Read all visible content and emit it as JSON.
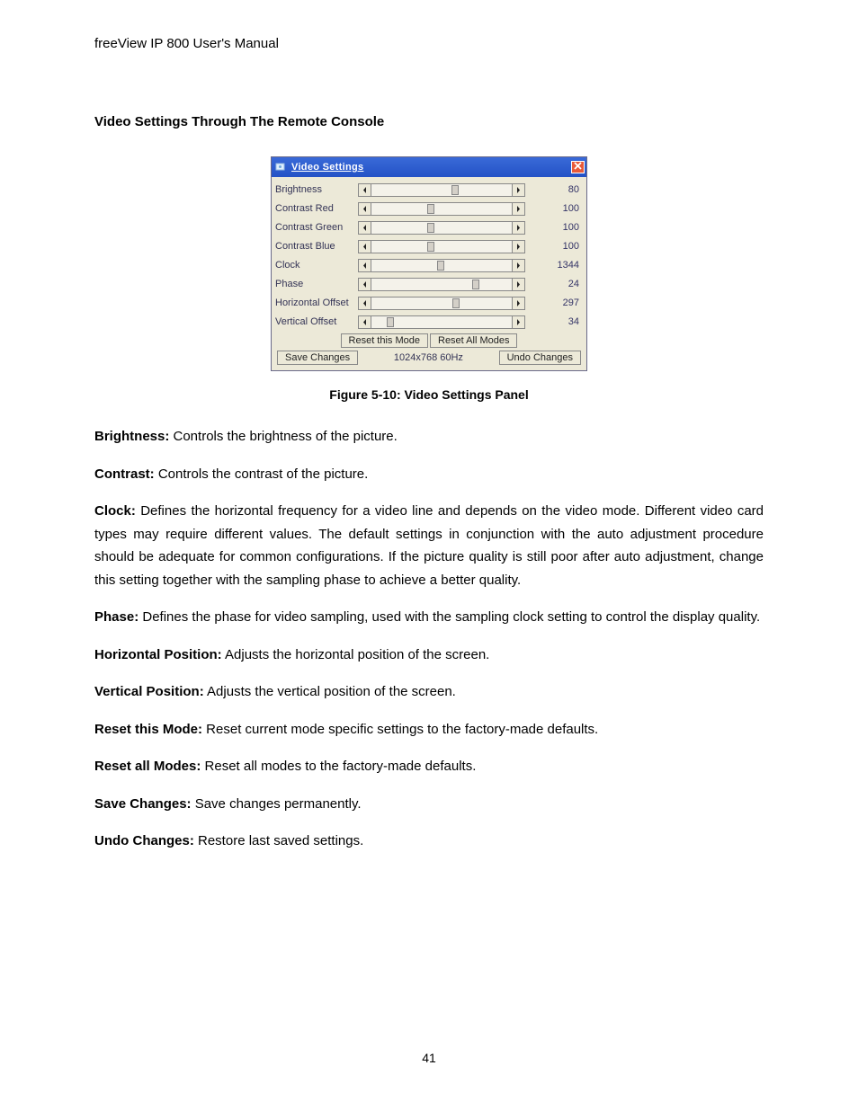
{
  "doc": {
    "running_head": "freeView IP 800 User's Manual",
    "section_title": "Video Settings Through The Remote Console",
    "figure_caption": "Figure 5-10: Video Settings Panel",
    "page_number": "41"
  },
  "panel": {
    "title": "Video Settings",
    "rows": [
      {
        "label": "Brightness",
        "value": "80",
        "pos": 57
      },
      {
        "label": "Contrast Red",
        "value": "100",
        "pos": 40
      },
      {
        "label": "Contrast Green",
        "value": "100",
        "pos": 40
      },
      {
        "label": "Contrast Blue",
        "value": "100",
        "pos": 40
      },
      {
        "label": "Clock",
        "value": "1344",
        "pos": 47
      },
      {
        "label": "Phase",
        "value": "24",
        "pos": 72
      },
      {
        "label": "Horizontal Offset",
        "value": "297",
        "pos": 58
      },
      {
        "label": "Vertical Offset",
        "value": "34",
        "pos": 11
      }
    ],
    "reset_mode": "Reset this Mode",
    "reset_all": "Reset All Modes",
    "save": "Save Changes",
    "undo": "Undo Changes",
    "mode_label": "1024x768 60Hz"
  },
  "defs": {
    "brightness_term": "Brightness:",
    "brightness_text": " Controls the brightness of the picture.",
    "contrast_term": "Contrast:",
    "contrast_text": " Controls the contrast of the picture.",
    "clock_term": "Clock:",
    "clock_text": " Defines the horizontal frequency for a video line and depends on the video mode. Different video card types may require different values. The default settings in conjunction with the auto adjustment procedure should be adequate for common configurations. If the picture quality is still poor after auto adjustment, change this setting together with the sampling phase to achieve a better quality.",
    "phase_term": "Phase:",
    "phase_text": " Defines the phase for video sampling, used with the sampling clock setting to control the display quality.",
    "hpos_term": "Horizontal Position:",
    "hpos_text": " Adjusts the horizontal position of the screen.",
    "vpos_term": "Vertical Position:",
    "vpos_text": " Adjusts the vertical position of the screen.",
    "resetmode_term": "Reset this Mode:",
    "resetmode_text": " Reset current mode specific settings to the factory-made defaults.",
    "resetall_term": "Reset all Modes:",
    "resetall_text": " Reset all modes to the factory-made defaults.",
    "save_term": "Save Changes:",
    "save_text": " Save changes permanently.",
    "undo_term": "Undo Changes:",
    "undo_text": " Restore last saved settings."
  }
}
